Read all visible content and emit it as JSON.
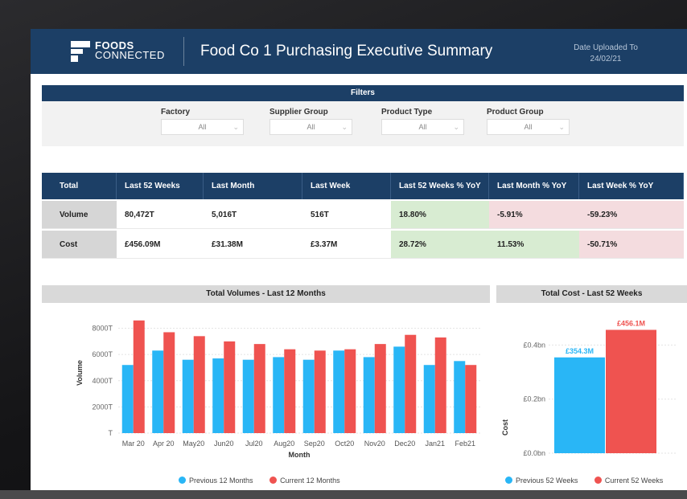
{
  "header": {
    "brand_line1": "FOODS",
    "brand_line2": "CONNECTED",
    "title": "Food Co 1 Purchasing Executive Summary",
    "date_label": "Date Uploaded To",
    "date_value": "24/02/21"
  },
  "filters": {
    "title": "Filters",
    "items": [
      {
        "label": "Factory",
        "value": "All"
      },
      {
        "label": "Supplier Group",
        "value": "All"
      },
      {
        "label": "Product Type",
        "value": "All"
      },
      {
        "label": "Product Group",
        "value": "All"
      }
    ]
  },
  "kpi": {
    "headers": [
      "Total",
      "Last 52 Weeks",
      "Last Month",
      "Last Week",
      "Last 52 Weeks % YoY",
      "Last Month % YoY",
      "Last Week % YoY"
    ],
    "rows": [
      {
        "label": "Volume",
        "cells": [
          "80,472T",
          "5,016T",
          "516T",
          "18.80%",
          "-5.91%",
          "-59.23%"
        ]
      },
      {
        "label": "Cost",
        "cells": [
          "£456.09M",
          "£31.38M",
          "£3.37M",
          "28.72%",
          "11.53%",
          "-50.71%"
        ]
      }
    ],
    "colors": {
      "positive": "#d8ecd2",
      "negative": "#f4dcdf"
    }
  },
  "volume_chart": {
    "title": "Total Volumes - Last 12 Months",
    "legend_previous": "Previous 12 Months",
    "legend_current": "Current 12 Months"
  },
  "cost_chart": {
    "title": "Total Cost - Last 52 Weeks",
    "legend_previous": "Previous 52 Weeks",
    "legend_current": "Current 52 Weeks"
  },
  "colors": {
    "previous": "#29b6f6",
    "current": "#ef5350",
    "navy": "#1c3f66"
  },
  "chart_data": [
    {
      "type": "bar",
      "title": "Total Volumes - Last 12 Months",
      "xlabel": "Month",
      "ylabel": "Volume",
      "categories": [
        "Mar 20",
        "Apr 20",
        "May20",
        "Jun20",
        "Jul20",
        "Aug20",
        "Sep20",
        "Oct20",
        "Nov20",
        "Dec20",
        "Jan21",
        "Feb21"
      ],
      "yticks": [
        0,
        2000,
        4000,
        6000,
        8000
      ],
      "ytick_labels": [
        "T",
        "2000T",
        "4000T",
        "6000T",
        "8000T"
      ],
      "ylim": [
        0,
        9200
      ],
      "grid": true,
      "legend": "bottom",
      "series": [
        {
          "name": "Previous 12 Months",
          "values": [
            5200,
            6300,
            5600,
            5700,
            5600,
            5800,
            5600,
            6300,
            5800,
            6600,
            5200,
            5500
          ]
        },
        {
          "name": "Current 12 Months",
          "values": [
            8600,
            7700,
            7400,
            7000,
            6800,
            6400,
            6300,
            6400,
            6800,
            7500,
            7300,
            5200
          ]
        }
      ]
    },
    {
      "type": "bar",
      "title": "Total Cost - Last 52 Weeks",
      "ylabel": "Cost",
      "categories": [
        ""
      ],
      "yticks": [
        0,
        0.2,
        0.4
      ],
      "ytick_labels": [
        "£0.0bn",
        "£0.2bn",
        "£0.4bn"
      ],
      "ylim": [
        0,
        0.52
      ],
      "grid": true,
      "legend": "bottom",
      "series": [
        {
          "name": "Previous 52 Weeks",
          "values": [
            0.3543
          ],
          "labels": [
            "£354.3M"
          ]
        },
        {
          "name": "Current 52 Weeks",
          "values": [
            0.4561
          ],
          "labels": [
            "£456.1M"
          ]
        }
      ]
    }
  ]
}
